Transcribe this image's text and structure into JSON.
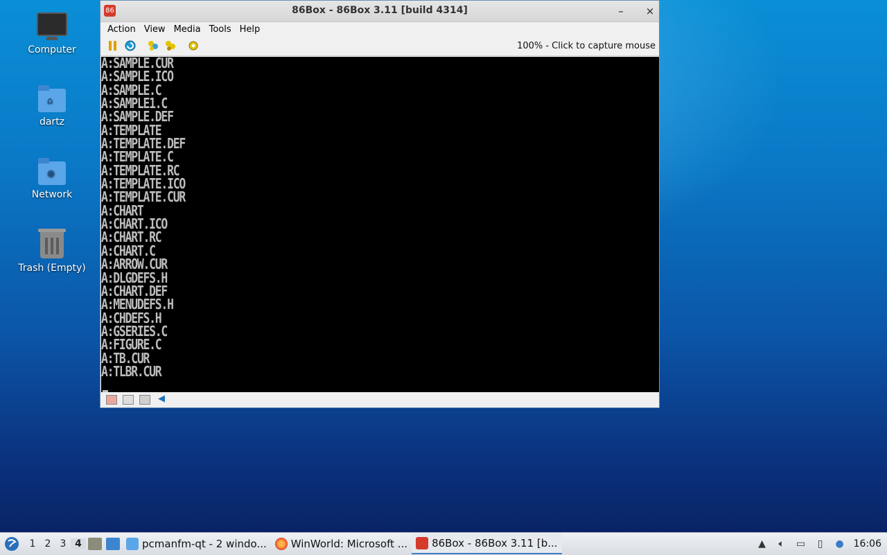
{
  "desktop": {
    "icons": [
      {
        "label": "Computer",
        "icon": "computer-icon"
      },
      {
        "label": "dartz",
        "icon": "home-folder-icon"
      },
      {
        "label": "Network",
        "icon": "network-folder-icon"
      },
      {
        "label": "Trash (Empty)",
        "icon": "trash-icon"
      }
    ]
  },
  "window": {
    "title": "86Box - 86Box 3.11 [build 4314]",
    "minimize_glyph": "–",
    "close_glyph": "×",
    "menu": [
      "Action",
      "View",
      "Media",
      "Tools",
      "Help"
    ],
    "toolbar": {
      "pause_icon": "pause-icon",
      "reset_icon": "reset-icon",
      "status_text": "100% - Click to capture mouse"
    },
    "console_lines": [
      "A:SAMPLE.CUR",
      "A:SAMPLE.ICO",
      "A:SAMPLE.C",
      "A:SAMPLE1.C",
      "A:SAMPLE.DEF",
      "A:TEMPLATE",
      "A:TEMPLATE.DEF",
      "A:TEMPLATE.C",
      "A:TEMPLATE.RC",
      "A:TEMPLATE.ICO",
      "A:TEMPLATE.CUR",
      "A:CHART",
      "A:CHART.ICO",
      "A:CHART.RC",
      "A:CHART.C",
      "A:ARROW.CUR",
      "A:DLGDEFS.H",
      "A:CHART.DEF",
      "A:MENUDEFS.H",
      "A:CHDEFS.H",
      "A:GSERIES.C",
      "A:FIGURE.C",
      "A:TB.CUR",
      "A:TLBR.CUR"
    ]
  },
  "taskbar": {
    "workspaces": [
      "1",
      "2",
      "3",
      "4"
    ],
    "active_workspace": "4",
    "tasks": [
      {
        "label": "pcmanfm-qt - 2 windo...",
        "icon": "folder-icon"
      },
      {
        "label": "WinWorld: Microsoft ...",
        "icon": "firefox-icon"
      },
      {
        "label": "86Box - 86Box 3.11 [b...",
        "icon": "86box-icon"
      }
    ],
    "clock": "16:06"
  },
  "colors": {
    "accent": "#3e7cc2",
    "console_text": "#bdbdbd",
    "console_bg": "#000000"
  }
}
